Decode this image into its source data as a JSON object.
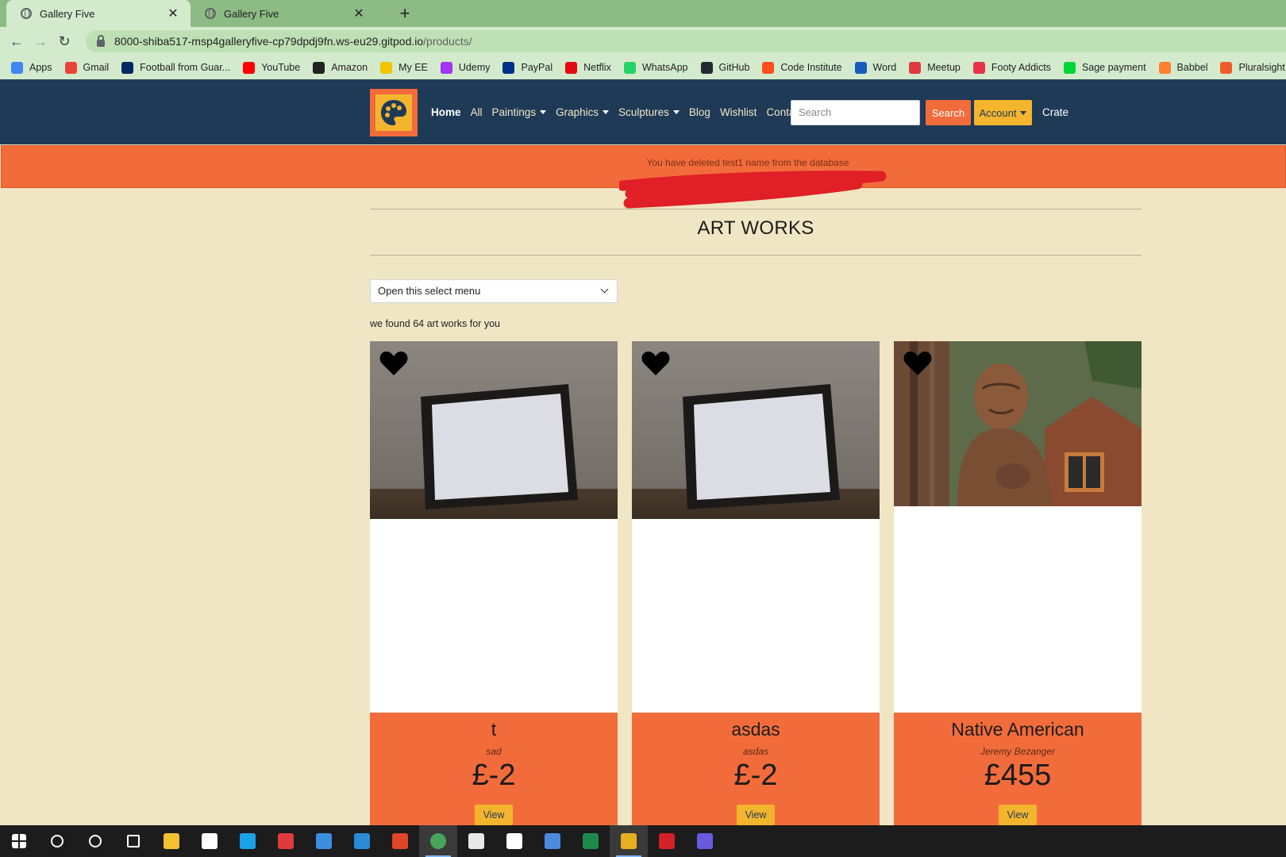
{
  "browser": {
    "tabs": [
      {
        "title": "Gallery Five",
        "active": true
      },
      {
        "title": "Gallery Five",
        "active": false
      }
    ],
    "url_host": "8000-shiba517-msp4galleryfive-cp79dpdj9fn.ws-eu29.gitpod.io",
    "url_path": "/products/",
    "bookmarks": [
      {
        "label": "Apps",
        "icon": "apps-grid-icon",
        "color": "#4285f4"
      },
      {
        "label": "Gmail",
        "icon": "gmail-icon",
        "color": "#ea4335"
      },
      {
        "label": "Football from Guar...",
        "icon": "guardian-icon",
        "color": "#052962"
      },
      {
        "label": "YouTube",
        "icon": "youtube-icon",
        "color": "#ff0000"
      },
      {
        "label": "Amazon",
        "icon": "amazon-icon",
        "color": "#222222"
      },
      {
        "label": "My EE",
        "icon": "ee-icon",
        "color": "#f2c500"
      },
      {
        "label": "Udemy",
        "icon": "udemy-icon",
        "color": "#a435f0"
      },
      {
        "label": "PayPal",
        "icon": "paypal-icon",
        "color": "#003087"
      },
      {
        "label": "Netflix",
        "icon": "netflix-icon",
        "color": "#e50914"
      },
      {
        "label": "WhatsApp",
        "icon": "whatsapp-icon",
        "color": "#25d366"
      },
      {
        "label": "GitHub",
        "icon": "github-icon",
        "color": "#24292e"
      },
      {
        "label": "Code Institute",
        "icon": "code-institute-icon",
        "color": "#ff4f1f"
      },
      {
        "label": "Word",
        "icon": "word-icon",
        "color": "#185abd"
      },
      {
        "label": "Meetup",
        "icon": "meetup-icon",
        "color": "#e0393e"
      },
      {
        "label": "Footy Addicts",
        "icon": "footy-addicts-icon",
        "color": "#e8334a"
      },
      {
        "label": "Sage payment",
        "icon": "sage-icon",
        "color": "#00d639"
      },
      {
        "label": "Babbel",
        "icon": "babbel-icon",
        "color": "#ff7f30"
      },
      {
        "label": "Pluralsight",
        "icon": "pluralsight-icon",
        "color": "#f15b2a"
      }
    ]
  },
  "nav": {
    "links": [
      {
        "label": "Home",
        "bold": true,
        "dropdown": false
      },
      {
        "label": "All",
        "bold": false,
        "dropdown": false
      },
      {
        "label": "Paintings",
        "bold": false,
        "dropdown": true
      },
      {
        "label": "Graphics",
        "bold": false,
        "dropdown": true
      },
      {
        "label": "Sculptures",
        "bold": false,
        "dropdown": true
      },
      {
        "label": "Blog",
        "bold": false,
        "dropdown": false
      },
      {
        "label": "Wishlist",
        "bold": false,
        "dropdown": false
      },
      {
        "label": "Contact",
        "bold": false,
        "dropdown": false
      }
    ],
    "search_placeholder": "Search",
    "search_button": "Search",
    "account_button": "Account",
    "crate_link": "Crate"
  },
  "alert": {
    "message": "You have deleted test1 name from the database"
  },
  "page": {
    "title": "ART WORKS",
    "select_value": "Open this select menu",
    "found_text": "we found 64 art works for you"
  },
  "products": [
    {
      "name": "t",
      "artist": "sad",
      "price": "£-2",
      "view_label": "View",
      "image": "empty-frame"
    },
    {
      "name": "asdas",
      "artist": "asdas",
      "price": "£-2",
      "view_label": "View",
      "image": "empty-frame"
    },
    {
      "name": "Native American",
      "artist": "Jeremy Bezanger",
      "price": "£455",
      "view_label": "View",
      "image": "wood-sculpture"
    }
  ],
  "colors": {
    "navy": "#1f3a57",
    "orange": "#f26c3b",
    "amber": "#f3b52e",
    "cream": "#f1e6c4"
  }
}
